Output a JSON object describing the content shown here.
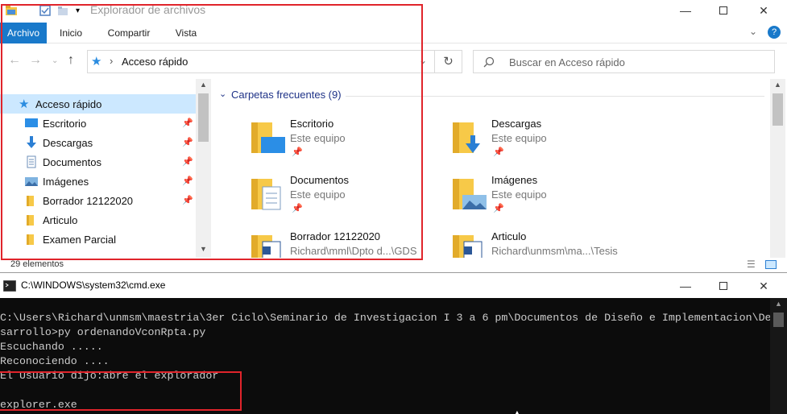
{
  "explorer": {
    "title": "Explorador de archivos",
    "tabs": [
      "Archivo",
      "Inicio",
      "Compartir",
      "Vista"
    ],
    "address": {
      "separator": "›",
      "path": "Acceso rápido"
    },
    "search_placeholder": "Buscar en Acceso rápido",
    "nav": {
      "header": "Acceso rápido",
      "items": [
        {
          "label": "Escritorio",
          "pinned": true,
          "icon": "desktop-icon"
        },
        {
          "label": "Descargas",
          "pinned": true,
          "icon": "download-icon"
        },
        {
          "label": "Documentos",
          "pinned": true,
          "icon": "documents-icon"
        },
        {
          "label": "Imágenes",
          "pinned": true,
          "icon": "pictures-icon"
        },
        {
          "label": "Borrador 12122020",
          "pinned": true,
          "icon": "folder-icon"
        },
        {
          "label": "Articulo",
          "pinned": false,
          "icon": "folder-icon"
        },
        {
          "label": "Examen Parcial",
          "pinned": false,
          "icon": "folder-icon"
        }
      ]
    },
    "group_header": "Carpetas frecuentes (9)",
    "tiles": [
      {
        "name": "Escritorio",
        "location": "Este equipo",
        "pinned": true
      },
      {
        "name": "Descargas",
        "location": "Este equipo",
        "pinned": true
      },
      {
        "name": "Documentos",
        "location": "Este equipo",
        "pinned": true
      },
      {
        "name": "Imágenes",
        "location": "Este equipo",
        "pinned": true
      },
      {
        "name": "Borrador 12122020",
        "location": "Richard\\mml\\Dpto d...\\GDS",
        "pinned": false
      },
      {
        "name": "Articulo",
        "location": "Richard\\unmsm\\ma...\\Tesis",
        "pinned": false
      }
    ],
    "status": "29 elementos",
    "colors": {
      "accent": "#1979ca",
      "selection": "#cce8ff",
      "highlight": "#e0242b"
    }
  },
  "cmd": {
    "title": "C:\\WINDOWS\\system32\\cmd.exe",
    "lines": [
      "C:\\Users\\Richard\\unmsm\\maestria\\3er Ciclo\\Seminario de Investigacion I 3 a 6 pm\\Documentos de Diseño e Implementacion\\De",
      "sarrollo>py ordenandoVconRpta.py",
      "Escuchando .....",
      "Reconociendo ....",
      "El Usuario dijo:abre el explorador",
      "",
      "explorer.exe"
    ]
  }
}
